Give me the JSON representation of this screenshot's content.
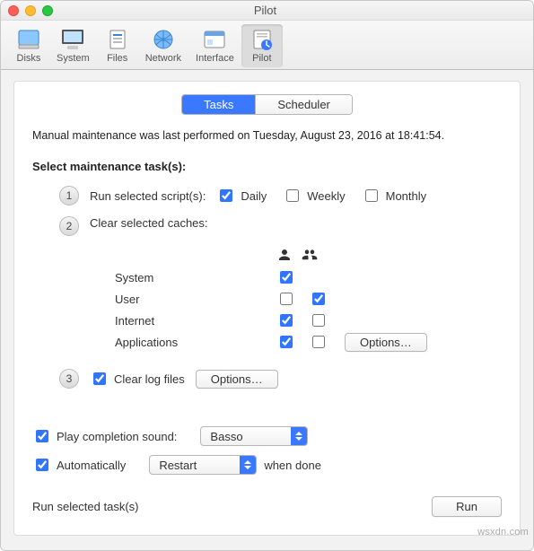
{
  "window": {
    "title": "Pilot"
  },
  "toolbar": {
    "items": [
      {
        "label": "Disks",
        "name": "toolbar-disks"
      },
      {
        "label": "System",
        "name": "toolbar-system"
      },
      {
        "label": "Files",
        "name": "toolbar-files"
      },
      {
        "label": "Network",
        "name": "toolbar-network"
      },
      {
        "label": "Interface",
        "name": "toolbar-interface"
      },
      {
        "label": "Pilot",
        "name": "toolbar-pilot",
        "selected": true
      }
    ]
  },
  "tabs": {
    "tasks": "Tasks",
    "scheduler": "Scheduler",
    "active": "tasks"
  },
  "status": "Manual maintenance was last performed on Tuesday, August 23, 2016 at 18:41:54.",
  "section_title": "Select maintenance task(s):",
  "step1": {
    "label": "Run selected script(s):",
    "daily": {
      "label": "Daily",
      "checked": true
    },
    "weekly": {
      "label": "Weekly",
      "checked": false
    },
    "monthly": {
      "label": "Monthly",
      "checked": false
    }
  },
  "step2": {
    "label": "Clear selected caches:",
    "rows": [
      {
        "label": "System",
        "user": true,
        "all": false,
        "options": false
      },
      {
        "label": "User",
        "user": false,
        "all": true,
        "options": false
      },
      {
        "label": "Internet",
        "user": true,
        "all": false,
        "options": false
      },
      {
        "label": "Applications",
        "user": true,
        "all": false,
        "options": true
      }
    ],
    "options_label": "Options…"
  },
  "step3": {
    "checkbox_label": "Clear log files",
    "checked": true,
    "options_label": "Options…"
  },
  "sound": {
    "checkbox_label": "Play completion sound:",
    "checked": true,
    "value": "Basso"
  },
  "auto": {
    "checkbox_label": "Automatically",
    "checked": true,
    "value": "Restart",
    "suffix": "when done"
  },
  "footer": {
    "label": "Run selected task(s)",
    "run": "Run"
  },
  "watermark": "wsxdn.com"
}
